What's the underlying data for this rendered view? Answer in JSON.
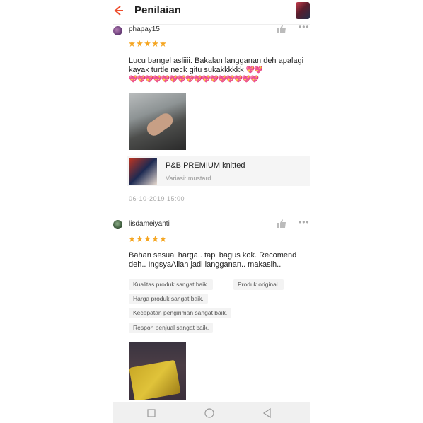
{
  "header": {
    "title": "Penilaian"
  },
  "reviews": [
    {
      "username": "phapay15",
      "rating": 5,
      "text": "Lucu bangel asliiii.  Bakalan langganan deh apalagi kayak turtle neck gitu sukakkkkkk",
      "hearts_line1": "💖💖",
      "hearts_line2": "💖💖💖💖💖💖💖💖💖💖💖💖💖💖💖💖",
      "product": {
        "name": "P&B PREMIUM knitted",
        "variant": "Variasi: mustard .."
      },
      "date": "06-10-2019 15:00"
    },
    {
      "username": "lisdameiyanti",
      "rating": 5,
      "text": "Bahan sesuai harga.. tapi bagus kok. Recomend deh.. IngsyaAllah jadi langganan.. makasih..",
      "tags": [
        "Kualitas produk sangat baik.",
        "Produk original.",
        "Harga produk sangat baik.",
        "Kecepatan pengiriman sangat baik.",
        "Respon penjual sangat baik."
      ]
    }
  ],
  "icons": {
    "back": "back-arrow-icon",
    "like": "thumbs-up-icon",
    "more": "more-icon",
    "star_color": "#f5a623",
    "accent": "#ee4d2d"
  },
  "navbar": {
    "recent": "square-icon",
    "home": "circle-icon",
    "back": "triangle-back-icon"
  }
}
